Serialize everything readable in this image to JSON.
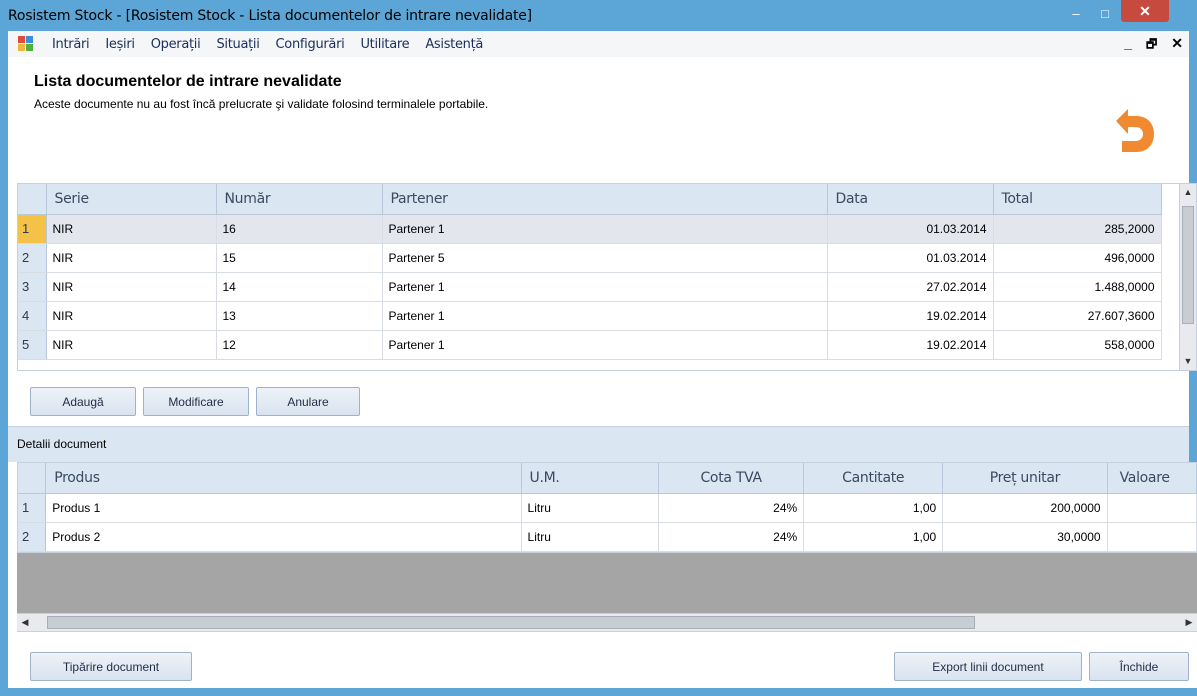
{
  "window": {
    "title": "Rosistem Stock - [Rosistem Stock - Lista documentelor de intrare nevalidate]",
    "minimize": "–",
    "maximize": "□",
    "close": "✕"
  },
  "menu": {
    "items": [
      "Intrări",
      "Ieșiri",
      "Operații",
      "Situații",
      "Configurări",
      "Utilitare",
      "Asistență"
    ],
    "mdi_minimize": "_",
    "mdi_restore": "🗗",
    "mdi_close": "✕"
  },
  "header": {
    "title": "Lista documentelor de intrare nevalidate",
    "subtitle": "Aceste documente nu au fost încă prelucrate şi validate folosind terminalele portabile."
  },
  "documents": {
    "columns": [
      "Serie",
      "Număr",
      "Partener",
      "Data",
      "Total"
    ],
    "rows": [
      {
        "n": "1",
        "serie": "NIR",
        "numar": "16",
        "partener": "Partener 1",
        "data": "01.03.2014",
        "total": "285,2000"
      },
      {
        "n": "2",
        "serie": "NIR",
        "numar": "15",
        "partener": "Partener 5",
        "data": "01.03.2014",
        "total": "496,0000"
      },
      {
        "n": "3",
        "serie": "NIR",
        "numar": "14",
        "partener": "Partener 1",
        "data": "27.02.2014",
        "total": "1.488,0000"
      },
      {
        "n": "4",
        "serie": "NIR",
        "numar": "13",
        "partener": "Partener 1",
        "data": "19.02.2014",
        "total": "27.607,3600"
      },
      {
        "n": "5",
        "serie": "NIR",
        "numar": "12",
        "partener": "Partener 1",
        "data": "19.02.2014",
        "total": "558,0000"
      }
    ]
  },
  "actions": {
    "add": "Adaugă",
    "modify": "Modificare",
    "cancel": "Anulare"
  },
  "details": {
    "section_title": "Detalii document",
    "columns": [
      "Produs",
      "U.M.",
      "Cota TVA",
      "Cantitate",
      "Preț unitar",
      "Valoare"
    ],
    "rows": [
      {
        "n": "1",
        "produs": "Produs 1",
        "um": "Litru",
        "cota": "24%",
        "cantitate": "1,00",
        "pret": "200,0000"
      },
      {
        "n": "2",
        "produs": "Produs 2",
        "um": "Litru",
        "cota": "24%",
        "cantitate": "1,00",
        "pret": "30,0000"
      }
    ]
  },
  "footer": {
    "print": "Tipărire document",
    "export": "Export linii document",
    "close": "Închide"
  },
  "colors": {
    "titlebar": "#5ba6d6",
    "close_button": "#c74a3f",
    "header_fill": "#dbe6f3",
    "selected_row_marker": "#f4c247",
    "back_arrow": "#f0892f"
  }
}
